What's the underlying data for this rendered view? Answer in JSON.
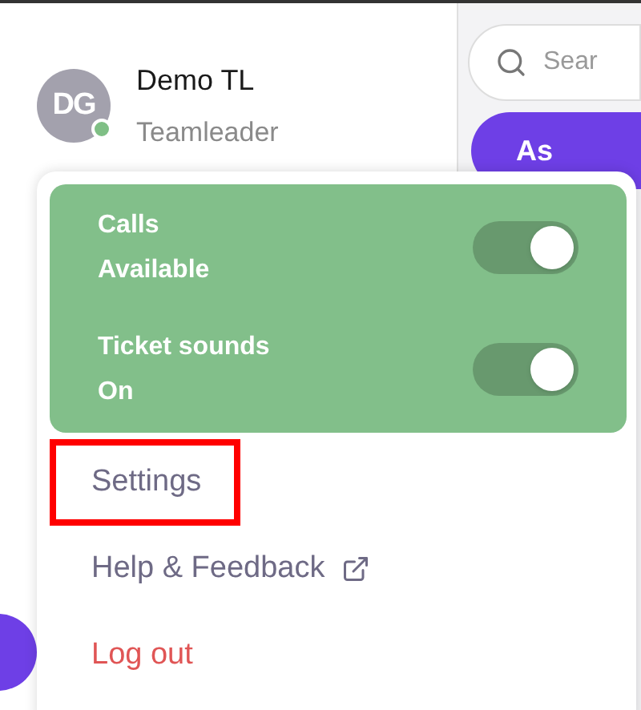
{
  "profile": {
    "initials": "DG",
    "online": true,
    "name": "Demo TL",
    "role": "Teamleader"
  },
  "search": {
    "placeholder": "Sear"
  },
  "action_button": {
    "label": "As"
  },
  "status_panel": {
    "toggles": [
      {
        "label": "Calls",
        "value": "Available",
        "on": true
      },
      {
        "label": "Ticket sounds",
        "value": "On",
        "on": true
      }
    ]
  },
  "menu": [
    {
      "label": "Settings",
      "kind": "plain",
      "highlighted": true
    },
    {
      "label": "Help & Feedback",
      "kind": "external",
      "highlighted": false
    },
    {
      "label": "Log out",
      "kind": "danger",
      "highlighted": false
    }
  ]
}
